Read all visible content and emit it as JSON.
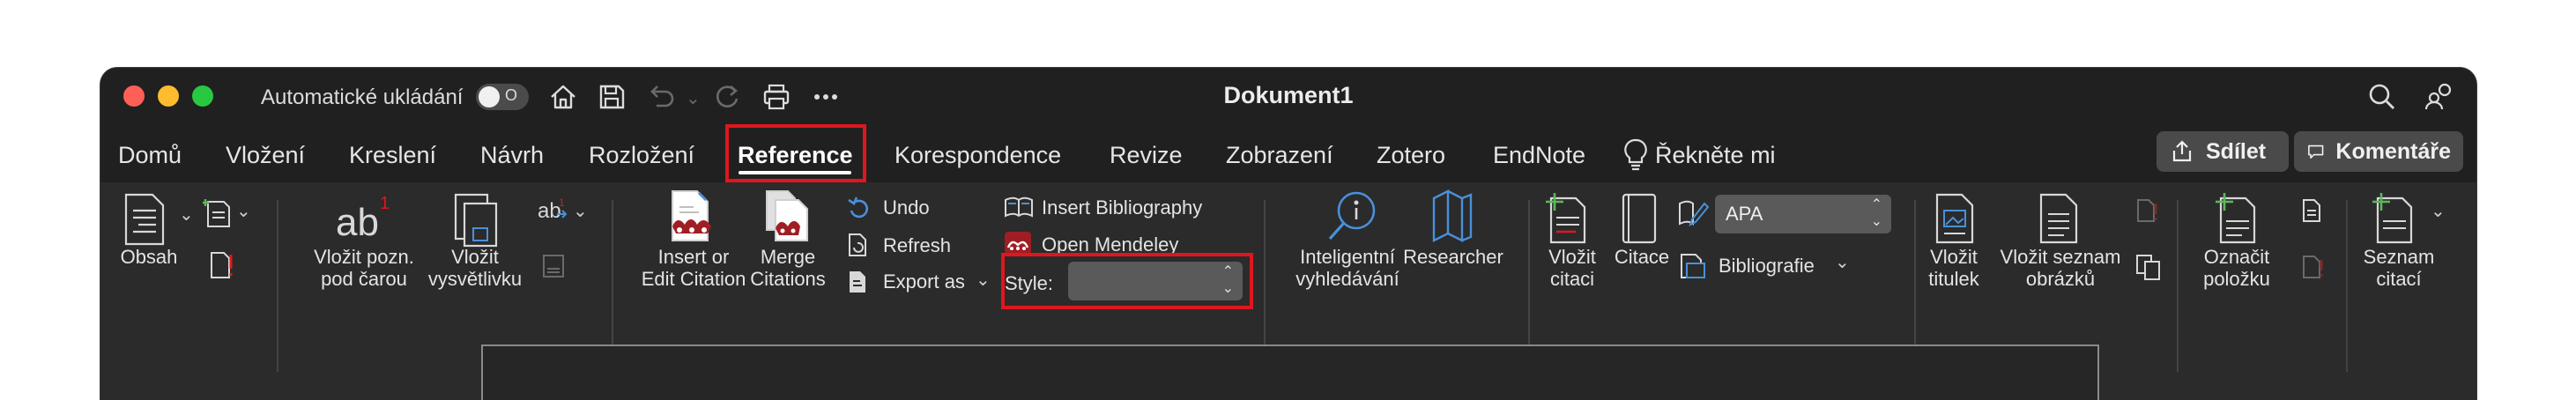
{
  "titlebar": {
    "autosave_label": "Automatické ukládání",
    "autosave_toggle_text": "O",
    "doc_title": "Dokument1"
  },
  "tabs": [
    {
      "label": "Domů"
    },
    {
      "label": "Vložení"
    },
    {
      "label": "Kreslení"
    },
    {
      "label": "Návrh"
    },
    {
      "label": "Rozložení"
    },
    {
      "label": "Reference",
      "active": true
    },
    {
      "label": "Korespondence"
    },
    {
      "label": "Revize"
    },
    {
      "label": "Zobrazení"
    },
    {
      "label": "Zotero"
    },
    {
      "label": "EndNote"
    },
    {
      "label": "Řekněte mi"
    }
  ],
  "top_buttons": {
    "share": "Sdílet",
    "comments": "Komentáře"
  },
  "ribbon": {
    "toc": "Obsah",
    "insert_footnote_l1": "Vložit pozn.",
    "insert_footnote_l2": "pod čarou",
    "insert_endnote_l1": "Vložit",
    "insert_endnote_l2": "vysvětlivku",
    "mendeley_insert_l1": "Insert or",
    "mendeley_insert_l2": "Edit Citation",
    "merge_l1": "Merge",
    "merge_l2": "Citations",
    "undo": "Undo",
    "refresh": "Refresh",
    "export_as": "Export as",
    "insert_bibliography": "Insert Bibliography",
    "open_mendeley": "Open Mendeley",
    "style_label": "Style:",
    "style_value": "",
    "smart_lookup_l1": "Inteligentní",
    "smart_lookup_l2": "vyhledávání",
    "researcher": "Researcher",
    "insert_citation_l1": "Vložit",
    "insert_citation_l2": "citaci",
    "citations": "Citace",
    "citation_style": "APA",
    "bibliography": "Bibliografie",
    "insert_caption_l1": "Vložit",
    "insert_caption_l2": "titulek",
    "table_of_figures_l1": "Vložit seznam",
    "table_of_figures_l2": "obrázků",
    "mark_entry_l1": "Označit",
    "mark_entry_l2": "položku",
    "table_of_authorities_l1": "Seznam",
    "table_of_authorities_l2": "citací"
  },
  "colors": {
    "highlight_red": "#e0161e",
    "mendeley_red": "#9f1e24",
    "accent_blue": "#4a90d9",
    "window_bg": "#202020",
    "ribbon_bg": "#2b2b2b"
  }
}
